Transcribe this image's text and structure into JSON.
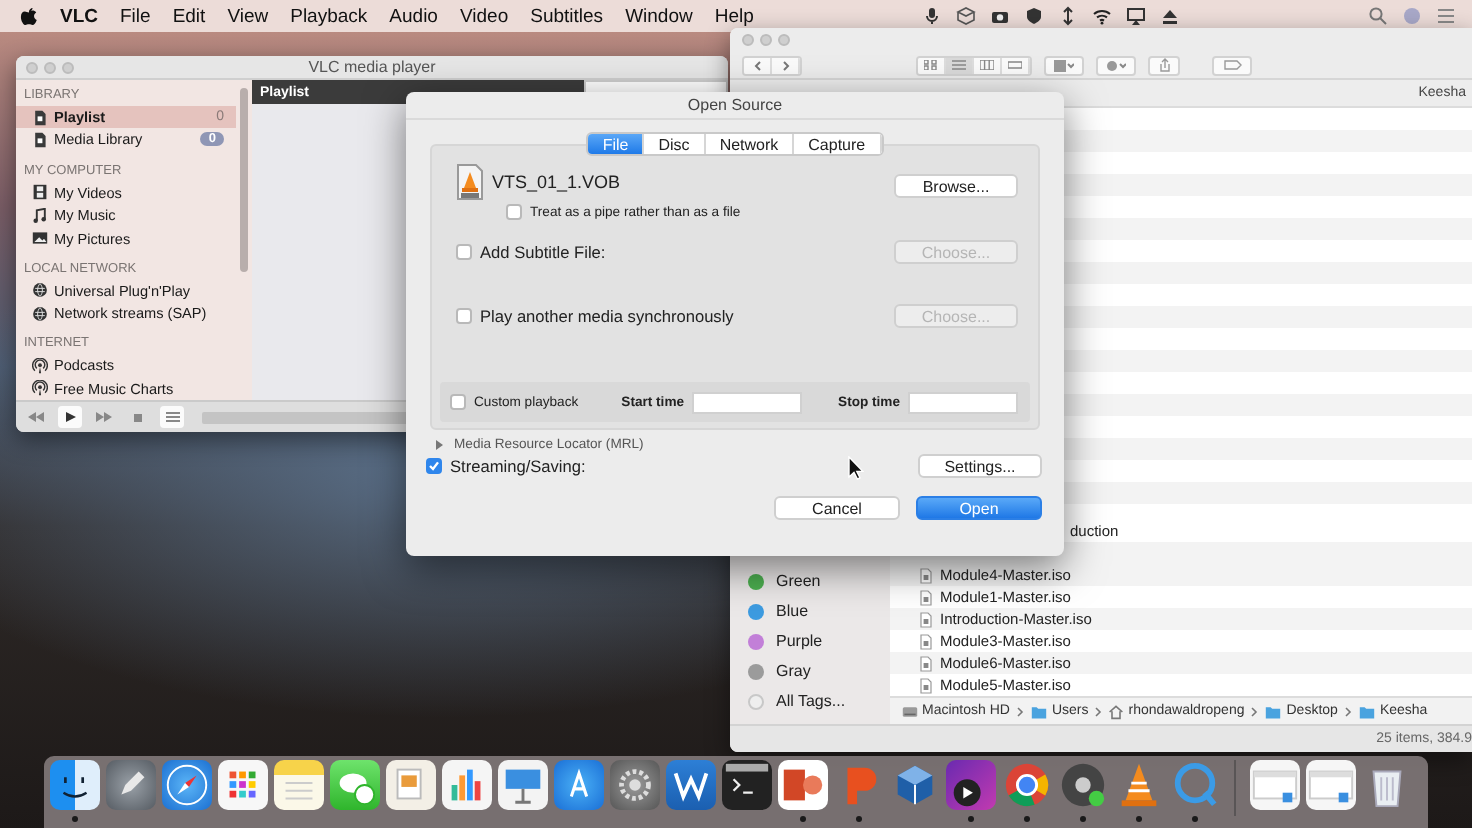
{
  "menu_bar": {
    "app": "VLC",
    "items": [
      "File",
      "Edit",
      "View",
      "Playback",
      "Audio",
      "Video",
      "Subtitles",
      "Window",
      "Help"
    ]
  },
  "vlc_window": {
    "title": "VLC media player",
    "playlist_header": "Playlist",
    "sidebar": [
      {
        "heading": "LIBRARY",
        "items": [
          {
            "label": "Playlist",
            "selected": true,
            "count": "0"
          },
          {
            "label": "Media Library",
            "selected": false,
            "badge": "0"
          }
        ]
      },
      {
        "heading": "MY COMPUTER",
        "items": [
          {
            "label": "My Videos",
            "selected": false
          },
          {
            "label": "My Music",
            "selected": false
          },
          {
            "label": "My Pictures",
            "selected": false
          }
        ]
      },
      {
        "heading": "LOCAL NETWORK",
        "items": [
          {
            "label": "Universal Plug'n'Play",
            "selected": false
          },
          {
            "label": "Network streams (SAP)",
            "selected": false
          }
        ]
      },
      {
        "heading": "INTERNET",
        "items": [
          {
            "label": "Podcasts",
            "selected": false
          },
          {
            "label": "Free Music Charts",
            "selected": false
          }
        ]
      }
    ]
  },
  "finder_window": {
    "view_modes": [
      {
        "selected": false
      },
      {
        "selected": true
      },
      {
        "selected": false
      },
      {
        "selected": false
      }
    ],
    "header": "Keesha",
    "tags": [
      {
        "kind": "color",
        "label": "Green",
        "color": "#4caf50"
      },
      {
        "kind": "color",
        "label": "Blue",
        "color": "#3d9be0"
      },
      {
        "kind": "color",
        "label": "Purple",
        "color": "#c27fd8"
      },
      {
        "kind": "color",
        "label": "Gray",
        "color": "#9b9b9b"
      },
      {
        "kind": "all",
        "label": "All Tags..."
      }
    ],
    "files": [
      {
        "kind": "partial",
        "name": "duction"
      },
      {
        "kind": "file",
        "name": "Module4-Master.iso"
      },
      {
        "kind": "file",
        "name": "Module1-Master.iso"
      },
      {
        "kind": "file",
        "name": "Introduction-Master.iso"
      },
      {
        "kind": "file",
        "name": "Module3-Master.iso"
      },
      {
        "kind": "file",
        "name": "Module6-Master.iso"
      },
      {
        "kind": "file",
        "name": "Module5-Master.iso"
      }
    ],
    "path": [
      "Macintosh HD",
      "Users",
      "rhondawaldropeng",
      "Desktop",
      "Keesha"
    ],
    "status": "25 items, 384.9"
  },
  "open_source_dialog": {
    "title": "Open Source",
    "tabs": [
      {
        "label": "File",
        "selected": true
      },
      {
        "label": "Disc",
        "selected": false
      },
      {
        "label": "Network",
        "selected": false
      },
      {
        "label": "Capture",
        "selected": false
      }
    ],
    "file_name": "VTS_01_1.VOB",
    "browse_button": "Browse...",
    "pipe_option": {
      "label": "Treat as a pipe rather than as a file",
      "checked": false
    },
    "subtitle": {
      "label": "Add Subtitle File:",
      "checked": false,
      "button": "Choose...",
      "button_disabled": true
    },
    "sync_media": {
      "label": "Play another media synchronously",
      "checked": false,
      "button": "Choose...",
      "button_disabled": true
    },
    "custom_playback": {
      "label": "Custom playback",
      "checked": false,
      "start_label": "Start time",
      "stop_label": "Stop time"
    },
    "mrl": {
      "label": "Media Resource Locator (MRL)",
      "expanded": false
    },
    "streaming": {
      "label": "Streaming/Saving:",
      "checked": true,
      "button": "Settings..."
    },
    "buttons": [
      {
        "label": "Cancel",
        "default": false
      },
      {
        "label": "Open",
        "default": true
      }
    ]
  },
  "dock": [
    {
      "running": true
    },
    {
      "running": false
    },
    {
      "running": false
    },
    {
      "running": false
    },
    {
      "running": false
    },
    {
      "running": false
    },
    {
      "running": false
    },
    {
      "running": false
    },
    {
      "running": false
    },
    {
      "running": false
    },
    {
      "running": false
    },
    {
      "running": false
    },
    {
      "running": false
    },
    {
      "running": true
    },
    {
      "running": true
    },
    {
      "running": false
    },
    {
      "running": true
    },
    {
      "running": true
    },
    {
      "running": true
    },
    {
      "running": true
    },
    {
      "running": true
    },
    {
      "running": false
    },
    {
      "running": false
    },
    {
      "running": false
    }
  ]
}
